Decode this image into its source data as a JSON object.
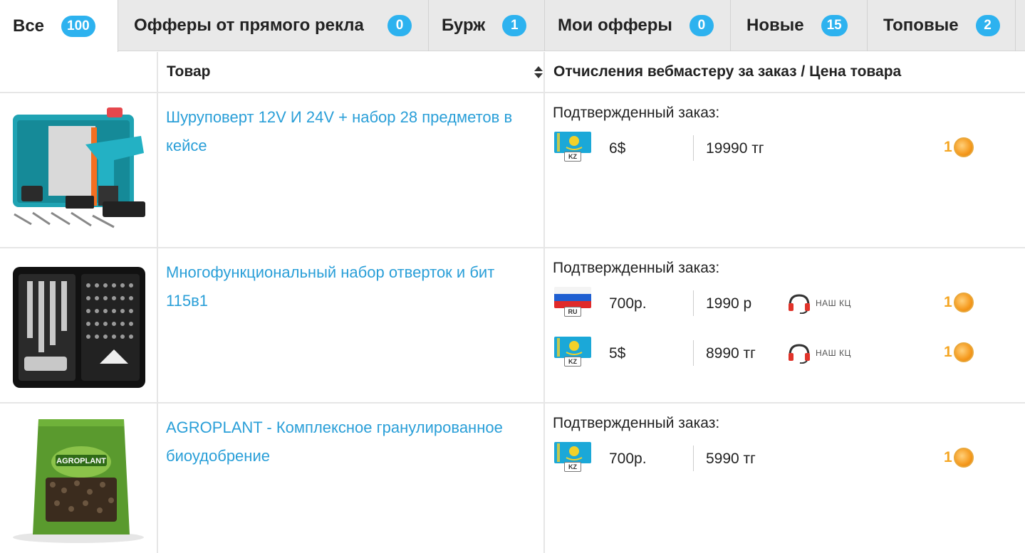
{
  "tabs": [
    {
      "label": "Все",
      "count": "100"
    },
    {
      "label": "Офферы от прямого рекла",
      "count": "0"
    },
    {
      "label": "Бурж",
      "count": "1"
    },
    {
      "label": "Мои офферы",
      "count": "0"
    },
    {
      "label": "Новые",
      "count": "15"
    },
    {
      "label": "Топовые",
      "count": "2"
    }
  ],
  "table": {
    "headers": {
      "image": "",
      "product": "Товар",
      "payout": "Отчисления вебмастеру за заказ / Цена товара"
    },
    "rows": [
      {
        "name": "Шуруповерт 12V И 24V + набор 28 предметов в кейсе",
        "confirmed_label": "Подтвержденный заказ:",
        "offers": [
          {
            "flag": "kz",
            "country_code": "KZ",
            "payout": "6$",
            "price": "19990 тг",
            "coins": "1"
          }
        ]
      },
      {
        "name": "Многофункциональный набор отверток и бит 115в1",
        "confirmed_label": "Подтвержденный заказ:",
        "offers": [
          {
            "flag": "ru",
            "country_code": "RU",
            "payout": "700р.",
            "price": "1990 р",
            "call_center": "НАШ КЦ",
            "coins": "1"
          },
          {
            "flag": "kz",
            "country_code": "KZ",
            "payout": "5$",
            "price": "8990 тг",
            "call_center": "НАШ КЦ",
            "coins": "1"
          }
        ]
      },
      {
        "name": "AGROPLANT - Комплексное гранулированное биоудобрение",
        "confirmed_label": "Подтвержденный заказ:",
        "package_text": "AGROPLANT",
        "offers": [
          {
            "flag": "kz",
            "country_code": "KZ",
            "payout": "700р.",
            "price": "5990 тг",
            "coins": "1"
          }
        ]
      }
    ]
  },
  "icons": {
    "sort": "sort-icon",
    "headset": "headset-icon",
    "coin": "coin-icon"
  },
  "colors": {
    "accent": "#2db2ef",
    "link": "#2a9fd8",
    "coin": "#f5a623",
    "kz_flag": "#1ba8d8",
    "kz_emblem": "#f2d12a"
  }
}
